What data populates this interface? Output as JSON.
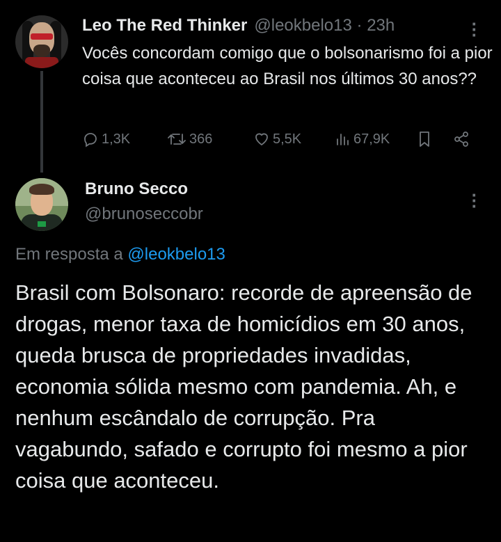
{
  "parent_tweet": {
    "display_name": "Leo The Red Thinker",
    "handle": "@leokbelo13",
    "separator": "·",
    "time": "23h",
    "text": "Vocês concordam comigo que o bolsonarismo foi a pior coisa que aconteceu ao Brasil nos últimos 30 anos??",
    "stats": {
      "replies": "1,3K",
      "retweets": "366",
      "likes": "5,5K",
      "views": "67,9K"
    }
  },
  "reply_tweet": {
    "display_name": "Bruno Secco",
    "handle": "@brunoseccobr",
    "replying_prefix": "Em resposta a",
    "replying_to": "@leokbelo13",
    "text": "Brasil com Bolsonaro: recorde de apreensão de drogas, menor taxa de homicídios em 30 anos, queda brusca de propriedades invadidas, economia sólida mesmo com pandemia. Ah, e nenhum escândalo de corrupção. Pra vagabundo, safado e corrupto foi mesmo a pior coisa que aconteceu."
  },
  "colors": {
    "background": "#000000",
    "primary_text": "#e7e9ea",
    "secondary_text": "#71767b",
    "link": "#1d9bf0",
    "thread_line": "#333639"
  },
  "icons": {
    "reply": "reply-icon",
    "retweet": "retweet-icon",
    "like": "heart-icon",
    "views": "views-icon",
    "bookmark": "bookmark-icon",
    "share": "share-icon",
    "more": "more-vertical-icon"
  }
}
